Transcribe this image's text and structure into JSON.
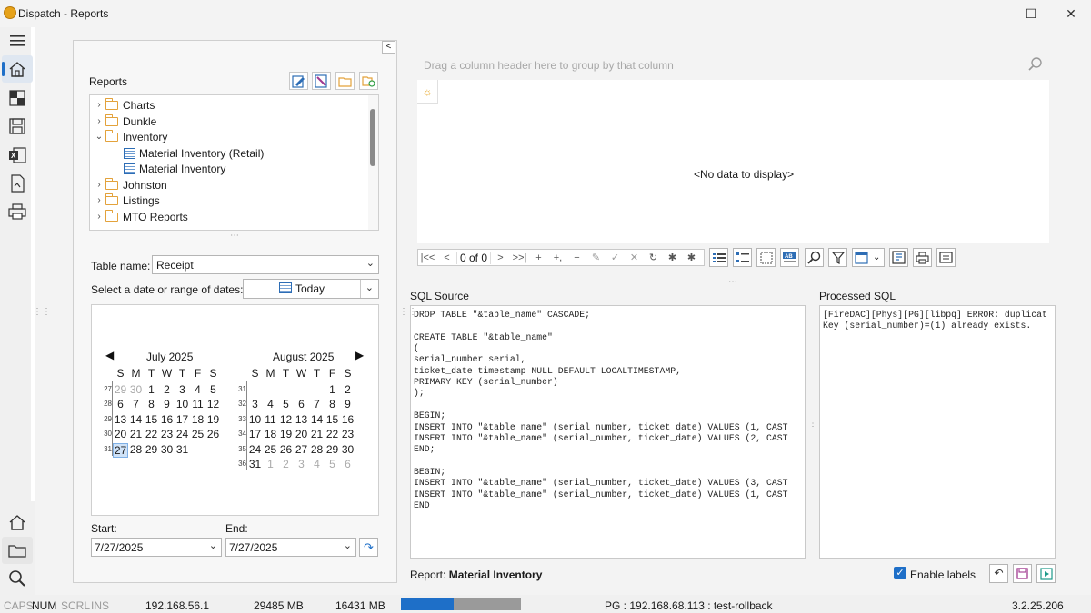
{
  "window": {
    "title": "Dispatch - Reports",
    "controls": {
      "minimize": "—",
      "maximize": "☐",
      "close": "✕"
    }
  },
  "left_rail": {
    "items": [
      "menu-icon",
      "home-icon",
      "dashboard-icon",
      "save-icon",
      "excel-icon",
      "script-icon",
      "printer-icon"
    ],
    "bottom_items": [
      "home-icon",
      "folder-icon",
      "search-icon"
    ]
  },
  "reports_panel": {
    "title": "Reports",
    "collapse": "<",
    "toolbar": [
      "edit-report-icon",
      "design-report-icon",
      "folder-icon",
      "new-folder-icon"
    ],
    "tree": [
      {
        "label": "Charts",
        "expanded": false,
        "type": "folder"
      },
      {
        "label": "Dunkle",
        "expanded": false,
        "type": "folder"
      },
      {
        "label": "Inventory",
        "expanded": true,
        "type": "folder",
        "children": [
          {
            "label": "Material Inventory (Retail)",
            "type": "report"
          },
          {
            "label": "Material Inventory",
            "type": "report"
          }
        ]
      },
      {
        "label": "Johnston",
        "expanded": false,
        "type": "folder"
      },
      {
        "label": "Listings",
        "expanded": false,
        "type": "folder"
      },
      {
        "label": "MTO Reports",
        "expanded": false,
        "type": "folder"
      }
    ],
    "table_name_label": "Table name:",
    "table_name_value": "Receipt",
    "date_label": "Select a date or range of dates:",
    "date_preset": "Today",
    "start_label": "Start:",
    "start_value": "7/27/2025",
    "end_label": "End:",
    "end_value": "7/27/2025"
  },
  "calendar": {
    "nav_prev": "◀",
    "nav_next": "▶",
    "day_headers": [
      "S",
      "M",
      "T",
      "W",
      "T",
      "F",
      "S"
    ],
    "months": [
      {
        "title": "July 2025",
        "weeks": [
          {
            "no": "27",
            "days": [
              "29",
              "30",
              "1",
              "2",
              "3",
              "4",
              "5"
            ]
          },
          {
            "no": "28",
            "days": [
              "6",
              "7",
              "8",
              "9",
              "10",
              "11",
              "12"
            ]
          },
          {
            "no": "29",
            "days": [
              "13",
              "14",
              "15",
              "16",
              "17",
              "18",
              "19"
            ]
          },
          {
            "no": "30",
            "days": [
              "20",
              "21",
              "22",
              "23",
              "24",
              "25",
              "26"
            ]
          },
          {
            "no": "31",
            "days": [
              "27",
              "28",
              "29",
              "30",
              "31",
              "",
              ""
            ]
          }
        ]
      },
      {
        "title": "August 2025",
        "weeks": [
          {
            "no": "31",
            "days": [
              "",
              "",
              "",
              "",
              "",
              "1",
              "2"
            ]
          },
          {
            "no": "32",
            "days": [
              "3",
              "4",
              "5",
              "6",
              "7",
              "8",
              "9"
            ]
          },
          {
            "no": "33",
            "days": [
              "10",
              "11",
              "12",
              "13",
              "14",
              "15",
              "16"
            ]
          },
          {
            "no": "34",
            "days": [
              "17",
              "18",
              "19",
              "20",
              "21",
              "22",
              "23"
            ]
          },
          {
            "no": "35",
            "days": [
              "24",
              "25",
              "26",
              "27",
              "28",
              "29",
              "30"
            ]
          },
          {
            "no": "36",
            "days": [
              "31",
              "1",
              "2",
              "3",
              "4",
              "5",
              "6"
            ]
          }
        ]
      }
    ],
    "selected": "27"
  },
  "grid": {
    "group_hint": "Drag a column header here to group by that column",
    "empty_text": "<No data to display>",
    "navigator": {
      "buttons": [
        "|<<",
        "<",
        ">",
        ">>|",
        "+",
        "+,",
        "−",
        "✎",
        "✓",
        "✕",
        "↻",
        "✱",
        "✱"
      ],
      "count": "0 of 0"
    },
    "toolbar": [
      "rows-icon",
      "list-icon",
      "grid-icon",
      "ab-icon",
      "find-icon",
      "filter-icon",
      "columns-icon",
      "export-icon",
      "print-icon",
      "preview-icon"
    ]
  },
  "sql_source": {
    "label": "SQL Source",
    "lines": [
      "DROP TABLE \"&table_name\" CASCADE;",
      "",
      "CREATE TABLE \"&table_name\"",
      "(",
      "serial_number serial,",
      "ticket_date timestamp NULL DEFAULT LOCALTIMESTAMP,",
      "PRIMARY KEY (serial_number)",
      ");",
      "",
      "BEGIN;",
      "INSERT INTO \"&table_name\" (serial_number, ticket_date) VALUES (1, CAST",
      "INSERT INTO \"&table_name\" (serial_number, ticket_date) VALUES (2, CAST",
      "END;",
      "",
      "BEGIN;",
      "INSERT INTO \"&table_name\" (serial_number, ticket_date) VALUES (3, CAST",
      "INSERT INTO \"&table_name\" (serial_number, ticket_date) VALUES (1, CAST",
      "END"
    ]
  },
  "processed_sql": {
    "label": "Processed SQL",
    "lines": [
      "[FireDAC][Phys][PG][libpq] ERROR: duplicat",
      "Key (serial_number)=(1) already exists."
    ]
  },
  "footer": {
    "report_prefix": "Report:",
    "report_name": "Material Inventory",
    "enable_labels": "Enable labels",
    "enable_labels_checked": true
  },
  "status_bar": {
    "caps": "CAPS",
    "num": "NUM",
    "scrl": "SCRL",
    "ins": "INS",
    "ip": "192.168.56.1",
    "mem1": "29485 MB",
    "mem2": "16431 MB",
    "progress": 0.44,
    "connection": "PG : 192.168.68.113 : test-rollback",
    "version": "3.2.25.206"
  },
  "colors": {
    "accent": "#1e6fc8",
    "folder": "#e3a23b",
    "selection": "#cfe2f7"
  }
}
